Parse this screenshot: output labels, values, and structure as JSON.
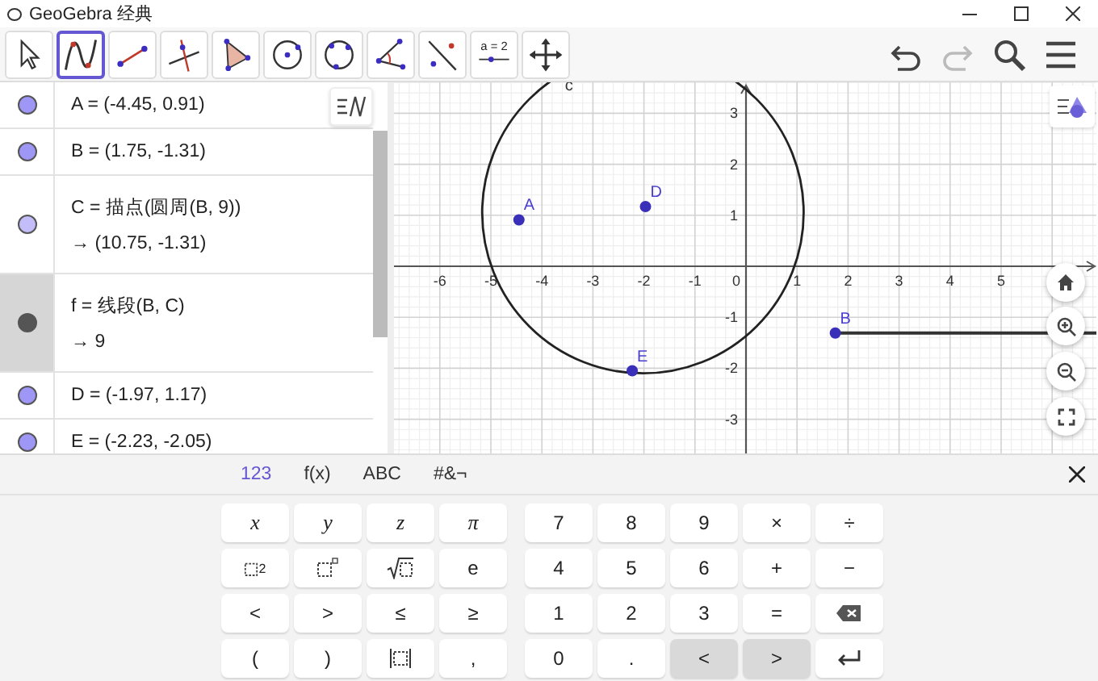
{
  "window": {
    "title": "GeoGebra 经典"
  },
  "toolbar": {
    "tools": [
      {
        "kind": "move",
        "selected": false
      },
      {
        "kind": "function",
        "selected": true
      },
      {
        "kind": "segment",
        "selected": false
      },
      {
        "kind": "perpendicular",
        "selected": false
      },
      {
        "kind": "polygon",
        "selected": false
      },
      {
        "kind": "circle-center",
        "selected": false
      },
      {
        "kind": "circle-three",
        "selected": false
      },
      {
        "kind": "angle",
        "selected": false
      },
      {
        "kind": "reflect",
        "selected": false
      },
      {
        "kind": "slider",
        "label": "a = 2",
        "selected": false
      },
      {
        "kind": "move-view",
        "selected": false
      }
    ],
    "actions": [
      {
        "kind": "undo",
        "disabled": false
      },
      {
        "kind": "redo",
        "disabled": true
      },
      {
        "kind": "search",
        "disabled": false
      },
      {
        "kind": "menu",
        "disabled": false
      }
    ]
  },
  "algebra": {
    "rows": [
      {
        "definition": "A = (-4.45, 0.91)",
        "color": "#9f97f5",
        "selected": false
      },
      {
        "definition": "B = (1.75, -1.31)",
        "color": "#9f97f5",
        "selected": false
      },
      {
        "definition": "C = 描点(圆周(B, 9))",
        "value": "→ (10.75, -1.31)",
        "color": "#c3befa",
        "selected": false
      },
      {
        "definition": "f = 线段(B, C)",
        "value": "→ 9",
        "color": "#555555",
        "selected": true
      },
      {
        "definition": "D = (-1.97, 1.17)",
        "color": "#9f97f5",
        "selected": false
      },
      {
        "definition": "E = (-2.23, -2.05)",
        "color": "#9f97f5",
        "selected": false
      }
    ]
  },
  "graphics": {
    "x_ticks": [
      "-6",
      "-5",
      "-4",
      "-3",
      "-2",
      "-1",
      "1",
      "2",
      "3",
      "4",
      "5"
    ],
    "origin_label": "0",
    "y_ticks": [
      "3",
      "2",
      "1",
      "-1",
      "-2",
      "-3"
    ],
    "circle_label": "c",
    "points": [
      {
        "label": "A"
      },
      {
        "label": "D"
      },
      {
        "label": "E"
      },
      {
        "label": "B"
      }
    ]
  },
  "keyboard": {
    "tabs": [
      {
        "label": "123",
        "selected": true
      },
      {
        "label": "f(x)",
        "selected": false
      },
      {
        "label": "ABC",
        "selected": false
      },
      {
        "label": "#&¬",
        "selected": false
      }
    ],
    "left_keys": [
      {
        "kind": "var",
        "label": "x"
      },
      {
        "kind": "var",
        "label": "y"
      },
      {
        "kind": "var",
        "label": "z"
      },
      {
        "kind": "var",
        "label": "π"
      },
      {
        "kind": "squared",
        "label": "2"
      },
      {
        "kind": "power"
      },
      {
        "kind": "sqrt"
      },
      {
        "kind": "text",
        "label": "e"
      },
      {
        "kind": "text",
        "label": "<"
      },
      {
        "kind": "text",
        "label": ">"
      },
      {
        "kind": "text",
        "label": "≤"
      },
      {
        "kind": "text",
        "label": "≥"
      },
      {
        "kind": "text",
        "label": "("
      },
      {
        "kind": "text",
        "label": ")"
      },
      {
        "kind": "abs"
      },
      {
        "kind": "text",
        "label": ","
      }
    ],
    "right_keys": [
      {
        "kind": "text",
        "label": "7"
      },
      {
        "kind": "text",
        "label": "8"
      },
      {
        "kind": "text",
        "label": "9"
      },
      {
        "kind": "text",
        "label": "×"
      },
      {
        "kind": "text",
        "label": "÷"
      },
      {
        "kind": "text",
        "label": "4"
      },
      {
        "kind": "text",
        "label": "5"
      },
      {
        "kind": "text",
        "label": "6"
      },
      {
        "kind": "text",
        "label": "+"
      },
      {
        "kind": "text",
        "label": "−"
      },
      {
        "kind": "text",
        "label": "1"
      },
      {
        "kind": "text",
        "label": "2"
      },
      {
        "kind": "text",
        "label": "3"
      },
      {
        "kind": "text",
        "label": "="
      },
      {
        "kind": "backspace"
      },
      {
        "kind": "text",
        "label": "0"
      },
      {
        "kind": "text",
        "label": "."
      },
      {
        "kind": "nav",
        "label": "<"
      },
      {
        "kind": "nav",
        "label": ">"
      },
      {
        "kind": "enter"
      }
    ]
  }
}
